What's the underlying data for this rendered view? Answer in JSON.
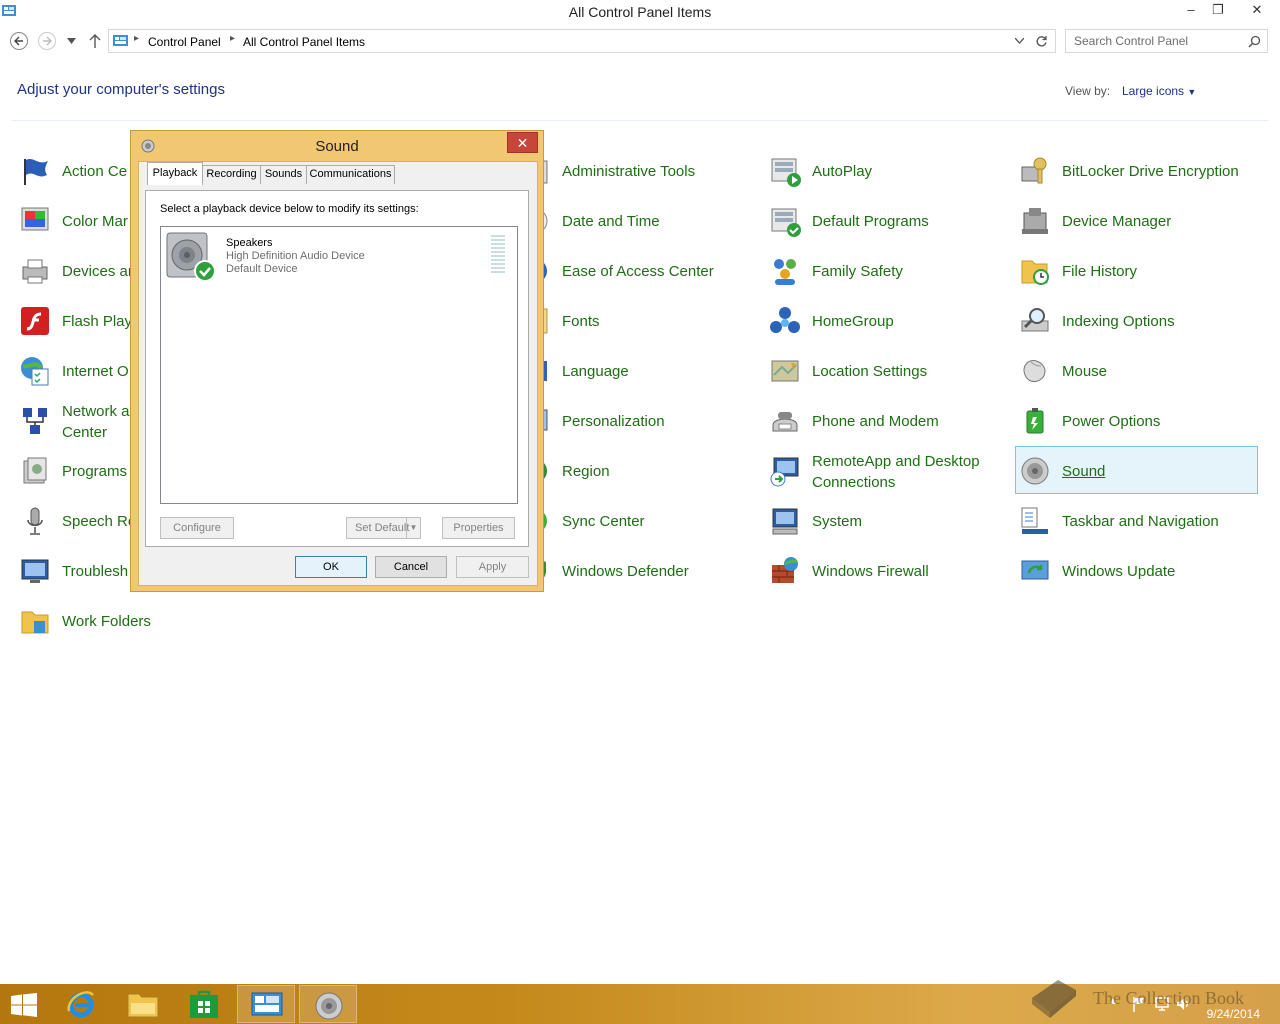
{
  "window": {
    "title": "All Control Panel Items",
    "minimize": "–",
    "restore": "❐",
    "close": "✕"
  },
  "address": {
    "crumbs": [
      "Control Panel",
      "All Control Panel Items"
    ],
    "search_placeholder": "Search Control Panel"
  },
  "header": {
    "title": "Adjust your computer's settings",
    "view_by_label": "View by:",
    "view_by_value": "Large icons"
  },
  "items": {
    "col1": [
      "Action Ce",
      "Color Mar",
      "Devices ar",
      "Flash Play",
      "Internet O",
      "Network a\nCenter",
      "Programs",
      "Speech Re",
      "Troublesh",
      "Work Folders"
    ],
    "col2": [
      "Administrative Tools",
      "Date and Time",
      "Ease of Access Center",
      "Fonts",
      "Language",
      "Personalization",
      "Region",
      "Sync Center",
      "Windows Defender"
    ],
    "col3": [
      "AutoPlay",
      "Default Programs",
      "Family Safety",
      "HomeGroup",
      "Location Settings",
      "Phone and Modem",
      "RemoteApp and Desktop Connections",
      "System",
      "Windows Firewall"
    ],
    "col4": [
      "BitLocker Drive Encryption",
      "Device Manager",
      "File History",
      "Indexing Options",
      "Mouse",
      "Power Options",
      "Sound",
      "Taskbar and Navigation",
      "Windows Update"
    ]
  },
  "dialog": {
    "title": "Sound",
    "close": "✕",
    "tabs": [
      "Playback",
      "Recording",
      "Sounds",
      "Communications"
    ],
    "instruction": "Select a playback device below to modify its settings:",
    "device": {
      "name": "Speakers",
      "description": "High Definition Audio Device",
      "status": "Default Device"
    },
    "buttons": {
      "configure": "Configure",
      "set_default": "Set Default",
      "properties": "Properties",
      "ok": "OK",
      "cancel": "Cancel",
      "apply": "Apply"
    }
  },
  "taskbar": {
    "date": "9/24/2014",
    "watermark": "The Collection Book"
  },
  "colors": {
    "link_green": "#1e6e14",
    "heading_blue": "#1e3287",
    "dialog_frame": "#f2c772",
    "taskbar": "#c5891b"
  }
}
